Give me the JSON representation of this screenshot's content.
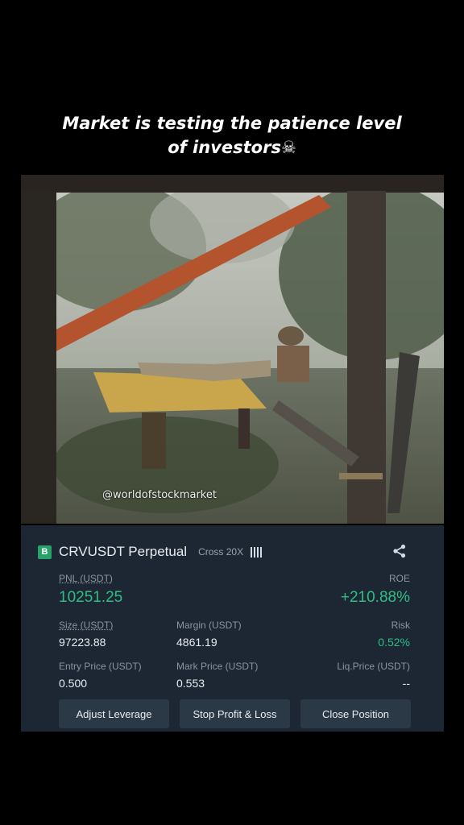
{
  "caption": {
    "line1": "Market is testing the patience level",
    "line2": "of investors",
    "emoji": "☠"
  },
  "photo": {
    "watermark": "@worldofstockmarket"
  },
  "position": {
    "badge": "B",
    "pair": "CRVUSDT Perpetual",
    "margin_mode": "Cross 20X",
    "leverage_bars": 4,
    "pnl_label": "PNL (USDT)",
    "pnl_value": "10251.25",
    "roe_label": "ROE",
    "roe_value": "+210.88%",
    "size_label": "Size (USDT)",
    "size_value": "97223.88",
    "margin_label": "Margin (USDT)",
    "margin_value": "4861.19",
    "risk_label": "Risk",
    "risk_value": "0.52%",
    "entry_label": "Entry Price (USDT)",
    "entry_value": "0.500",
    "mark_label": "Mark Price (USDT)",
    "mark_value": "0.553",
    "liq_label": "Liq.Price (USDT)",
    "liq_value": "--"
  },
  "buttons": {
    "adjust": "Adjust Leverage",
    "stop": "Stop Profit & Loss",
    "close": "Close Position"
  },
  "colors": {
    "accent_green": "#2ebd85",
    "card_bg": "#1d2733",
    "button_bg": "#2b3846"
  }
}
